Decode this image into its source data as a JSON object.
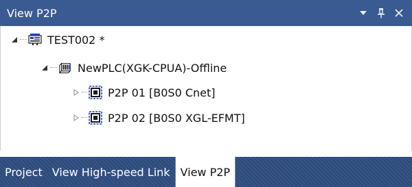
{
  "panel": {
    "title": "View P2P",
    "buttons": {
      "dropdown": "chevron-down-icon",
      "pin": "pin-icon",
      "close": "close-icon"
    }
  },
  "tree": {
    "root": {
      "label": "TEST002 *",
      "icon": "project-icon",
      "expanded": true
    },
    "plc": {
      "label": "NewPLC(XGK-CPUA)-Offline",
      "icon": "plc-icon",
      "expanded": true
    },
    "items": [
      {
        "label": "P2P 01 [B0S0 Cnet]",
        "icon": "p2p-module-icon",
        "expanded": false
      },
      {
        "label": "P2P 02 [B0S0 XGL-EFMT]",
        "icon": "p2p-module-icon",
        "expanded": false
      }
    ]
  },
  "tabs": [
    {
      "label": "Project",
      "active": false
    },
    {
      "label": "View High-speed Link",
      "active": false
    },
    {
      "label": "View P2P",
      "active": true
    }
  ],
  "colors": {
    "titlebar": "#3a5a92",
    "tabstrip": "#2c4a7c",
    "icon_blue": "#1a3fbf",
    "icon_frame": "#1b1b1b"
  }
}
